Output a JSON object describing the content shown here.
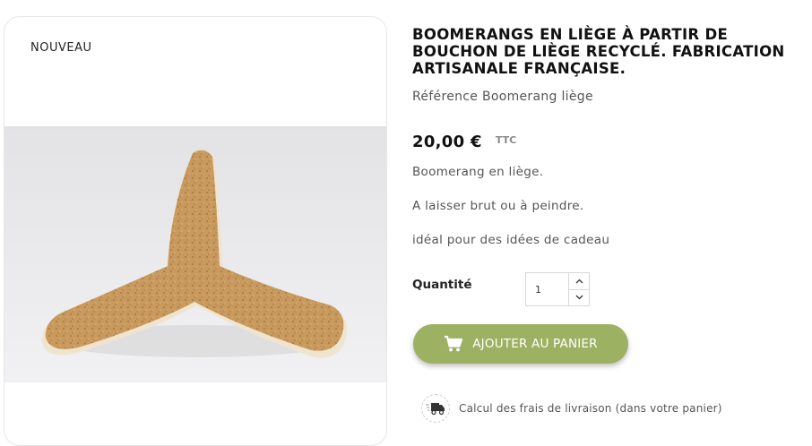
{
  "product": {
    "badge": "NOUVEAU",
    "title": "BOOMERANGS EN LIÈGE À PARTIR DE BOUCHON DE LIÈGE RECYCLÉ. FABRICATION ARTISANALE FRANÇAISE.",
    "reference": "Référence Boomerang liège",
    "price": "20,00 €",
    "tax_label": "TTC",
    "description": [
      "Boomerang en liège.",
      "A laisser brut ou à peindre.",
      "idéal pour des idées de cadeau"
    ],
    "image_icon": "cork-boomerang-photo"
  },
  "quantity": {
    "label": "Quantité",
    "value": "1",
    "up_icon": "chevron-up-icon",
    "down_icon": "chevron-down-icon"
  },
  "cart": {
    "button_label": "AJOUTER AU PANIER",
    "icon": "shopping-cart-icon",
    "color": "#9db163"
  },
  "shipping": {
    "text": "Calcul des frais de livraison (dans votre panier)",
    "icon": "delivery-truck-icon"
  }
}
